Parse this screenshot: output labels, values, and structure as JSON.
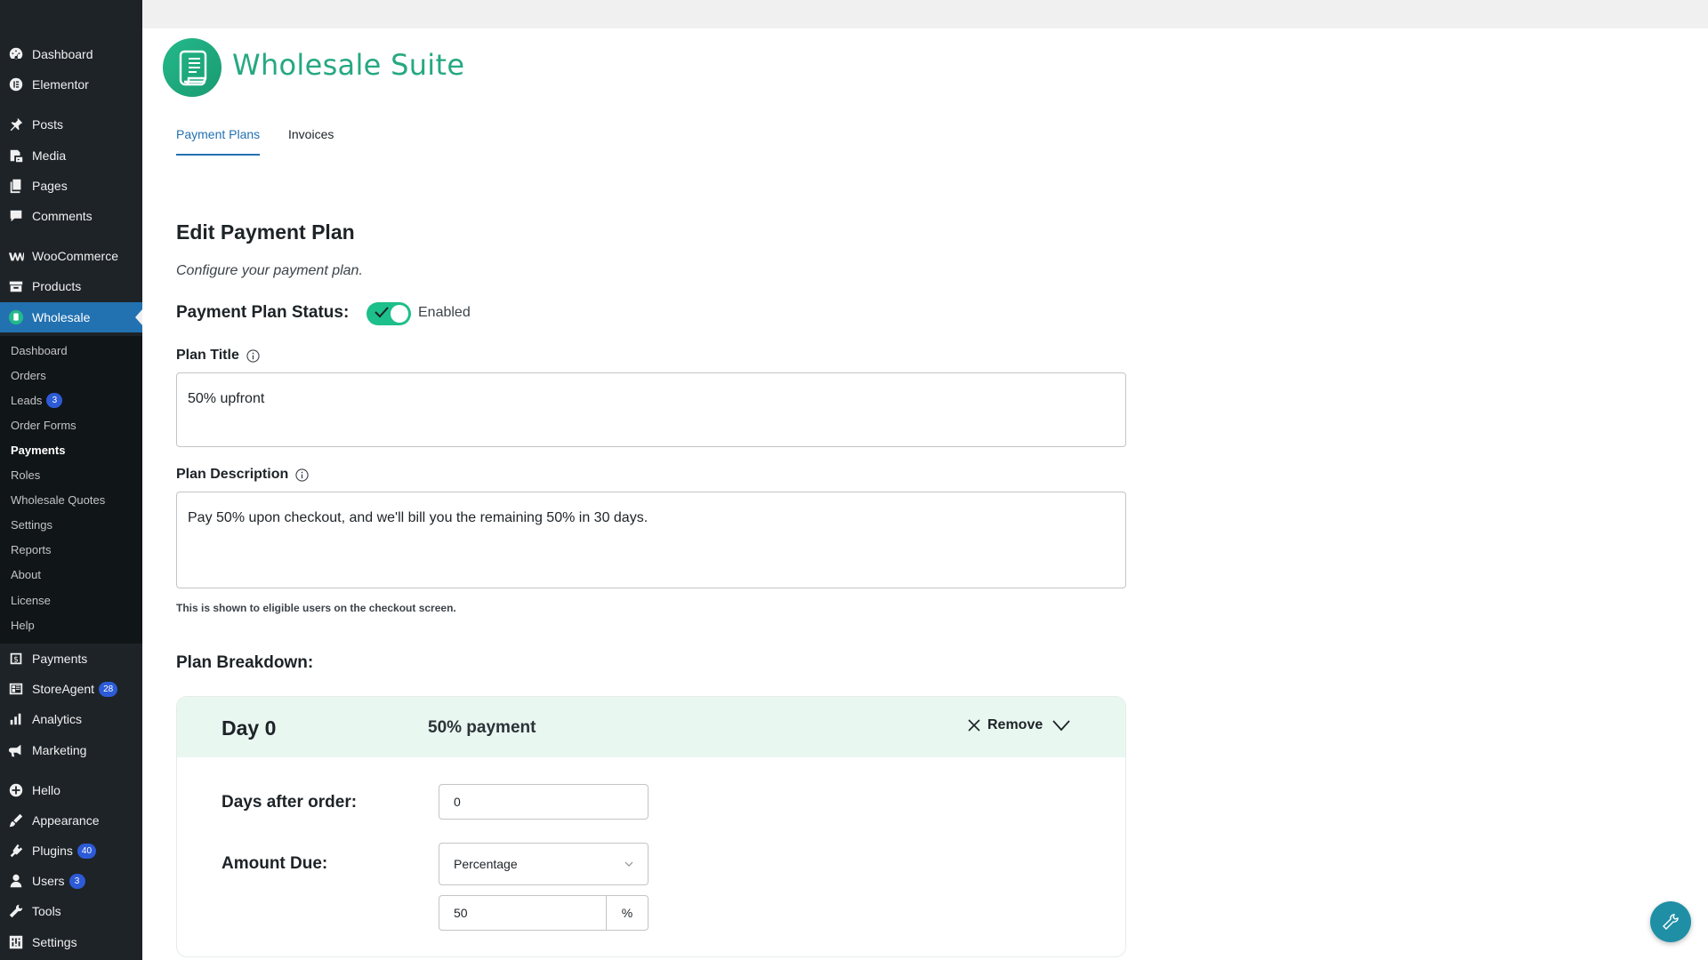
{
  "sidebar": {
    "items": [
      {
        "label": "Dashboard",
        "icon": "dashboard-icon"
      },
      {
        "label": "Elementor",
        "icon": "elementor-icon"
      },
      {
        "label": "Posts",
        "icon": "pin-icon"
      },
      {
        "label": "Media",
        "icon": "media-icon"
      },
      {
        "label": "Pages",
        "icon": "pages-icon"
      },
      {
        "label": "Comments",
        "icon": "comments-icon"
      },
      {
        "label": "WooCommerce",
        "icon": "woocommerce-icon"
      },
      {
        "label": "Products",
        "icon": "products-icon"
      },
      {
        "label": "Wholesale",
        "icon": "wholesale-icon"
      },
      {
        "label": "Payments",
        "icon": "payments-icon"
      },
      {
        "label": "StoreAgent",
        "icon": "storeagent-icon",
        "badge": "28"
      },
      {
        "label": "Analytics",
        "icon": "analytics-icon"
      },
      {
        "label": "Marketing",
        "icon": "marketing-icon"
      },
      {
        "label": "Hello",
        "icon": "hello-icon"
      },
      {
        "label": "Appearance",
        "icon": "appearance-icon"
      },
      {
        "label": "Plugins",
        "icon": "plugins-icon",
        "badge": "40"
      },
      {
        "label": "Users",
        "icon": "users-icon",
        "badge": "3"
      },
      {
        "label": "Tools",
        "icon": "tools-icon"
      },
      {
        "label": "Settings",
        "icon": "settings-icon"
      }
    ],
    "submenu": [
      {
        "label": "Dashboard"
      },
      {
        "label": "Orders"
      },
      {
        "label": "Leads",
        "badge": "3"
      },
      {
        "label": "Order Forms"
      },
      {
        "label": "Payments"
      },
      {
        "label": "Roles"
      },
      {
        "label": "Wholesale Quotes"
      },
      {
        "label": "Settings"
      },
      {
        "label": "Reports"
      },
      {
        "label": "About"
      },
      {
        "label": "License"
      },
      {
        "label": "Help"
      }
    ],
    "active_item": "Wholesale",
    "current_submenu": "Payments"
  },
  "brand": {
    "name": "Wholesale Suite"
  },
  "tabs": [
    {
      "label": "Payment Plans",
      "active": true
    },
    {
      "label": "Invoices",
      "active": false
    }
  ],
  "form": {
    "title": "Edit Payment Plan",
    "subtitle": "Configure your payment plan.",
    "status_label": "Payment Plan Status:",
    "status_text": "Enabled",
    "status_enabled": true,
    "plan_title_label": "Plan Title",
    "plan_title_value": "50% upfront",
    "plan_description_label": "Plan Description",
    "plan_description_value": "Pay 50% upon checkout, and we'll bill you the remaining 50% in 30 days.",
    "description_hint": "This is shown to eligible users on the checkout screen.",
    "breakdown_label": "Plan Breakdown:"
  },
  "breakdown": [
    {
      "day_title": "Day 0",
      "amount_summary": "50% payment",
      "remove_label": "Remove",
      "days_after_label": "Days after order:",
      "days_after_value": "0",
      "amount_due_label": "Amount Due:",
      "amount_type": "Percentage",
      "amount_value": "50",
      "amount_unit": "%"
    }
  ],
  "colors": {
    "sidebar_bg": "#1d2327",
    "accent": "#2271b1",
    "brand_green": "#26a882",
    "toggle_on": "#1dbf8a",
    "card_header": "#e9f7f1"
  }
}
